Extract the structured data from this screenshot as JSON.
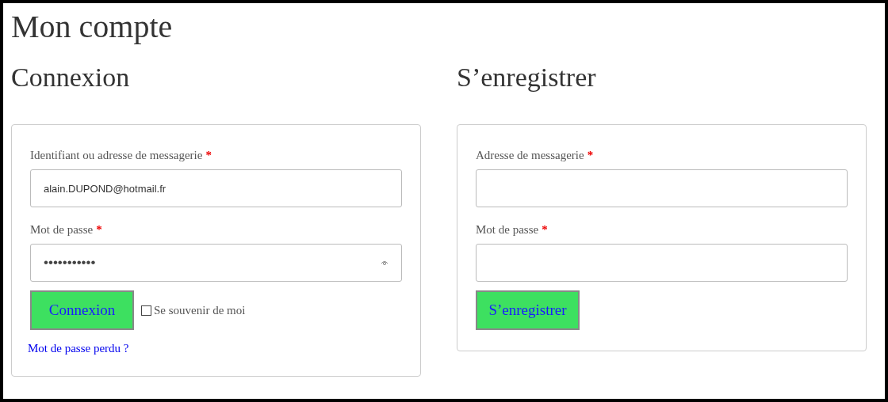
{
  "page_title": "Mon compte",
  "login": {
    "heading": "Connexion",
    "fields": [
      {
        "kind": "text",
        "label": "Identifiant ou adresse de messagerie",
        "required_mark": "*",
        "value": "alain.DUPOND@hotmail.fr"
      },
      {
        "kind": "password",
        "label": "Mot de passe",
        "required_mark": "*",
        "value": "•••••••••••"
      }
    ],
    "submit": "Connexion",
    "remember": {
      "label": "Se souvenir de moi",
      "checked": false
    },
    "lost_password": "Mot de passe perdu ?"
  },
  "register": {
    "heading": "S’enregistrer",
    "fields": [
      {
        "kind": "text",
        "label": "Adresse de messagerie",
        "required_mark": "*"
      },
      {
        "kind": "text",
        "label": "Mot de passe",
        "required_mark": "*"
      }
    ],
    "submit": "S’enregistrer"
  }
}
